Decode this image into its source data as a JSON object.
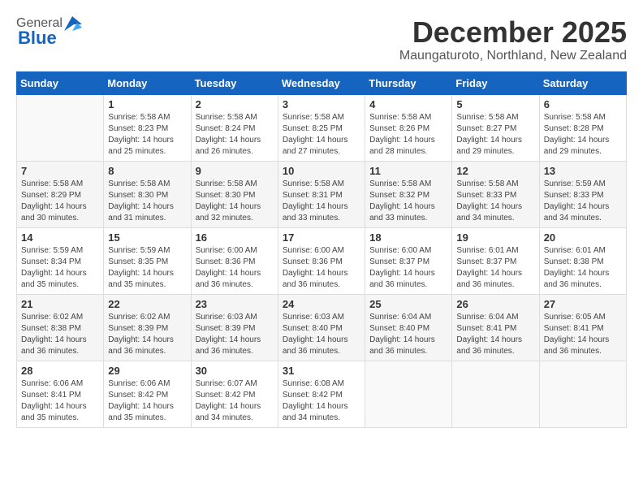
{
  "logo": {
    "general": "General",
    "blue": "Blue"
  },
  "title": {
    "month": "December 2025",
    "location": "Maungaturoto, Northland, New Zealand"
  },
  "weekdays": [
    "Sunday",
    "Monday",
    "Tuesday",
    "Wednesday",
    "Thursday",
    "Friday",
    "Saturday"
  ],
  "weeks": [
    [
      {
        "day": "",
        "info": ""
      },
      {
        "day": "1",
        "info": "Sunrise: 5:58 AM\nSunset: 8:23 PM\nDaylight: 14 hours\nand 25 minutes."
      },
      {
        "day": "2",
        "info": "Sunrise: 5:58 AM\nSunset: 8:24 PM\nDaylight: 14 hours\nand 26 minutes."
      },
      {
        "day": "3",
        "info": "Sunrise: 5:58 AM\nSunset: 8:25 PM\nDaylight: 14 hours\nand 27 minutes."
      },
      {
        "day": "4",
        "info": "Sunrise: 5:58 AM\nSunset: 8:26 PM\nDaylight: 14 hours\nand 28 minutes."
      },
      {
        "day": "5",
        "info": "Sunrise: 5:58 AM\nSunset: 8:27 PM\nDaylight: 14 hours\nand 29 minutes."
      },
      {
        "day": "6",
        "info": "Sunrise: 5:58 AM\nSunset: 8:28 PM\nDaylight: 14 hours\nand 29 minutes."
      }
    ],
    [
      {
        "day": "7",
        "info": "Sunrise: 5:58 AM\nSunset: 8:29 PM\nDaylight: 14 hours\nand 30 minutes."
      },
      {
        "day": "8",
        "info": "Sunrise: 5:58 AM\nSunset: 8:30 PM\nDaylight: 14 hours\nand 31 minutes."
      },
      {
        "day": "9",
        "info": "Sunrise: 5:58 AM\nSunset: 8:30 PM\nDaylight: 14 hours\nand 32 minutes."
      },
      {
        "day": "10",
        "info": "Sunrise: 5:58 AM\nSunset: 8:31 PM\nDaylight: 14 hours\nand 33 minutes."
      },
      {
        "day": "11",
        "info": "Sunrise: 5:58 AM\nSunset: 8:32 PM\nDaylight: 14 hours\nand 33 minutes."
      },
      {
        "day": "12",
        "info": "Sunrise: 5:58 AM\nSunset: 8:33 PM\nDaylight: 14 hours\nand 34 minutes."
      },
      {
        "day": "13",
        "info": "Sunrise: 5:59 AM\nSunset: 8:33 PM\nDaylight: 14 hours\nand 34 minutes."
      }
    ],
    [
      {
        "day": "14",
        "info": "Sunrise: 5:59 AM\nSunset: 8:34 PM\nDaylight: 14 hours\nand 35 minutes."
      },
      {
        "day": "15",
        "info": "Sunrise: 5:59 AM\nSunset: 8:35 PM\nDaylight: 14 hours\nand 35 minutes."
      },
      {
        "day": "16",
        "info": "Sunrise: 6:00 AM\nSunset: 8:36 PM\nDaylight: 14 hours\nand 36 minutes."
      },
      {
        "day": "17",
        "info": "Sunrise: 6:00 AM\nSunset: 8:36 PM\nDaylight: 14 hours\nand 36 minutes."
      },
      {
        "day": "18",
        "info": "Sunrise: 6:00 AM\nSunset: 8:37 PM\nDaylight: 14 hours\nand 36 minutes."
      },
      {
        "day": "19",
        "info": "Sunrise: 6:01 AM\nSunset: 8:37 PM\nDaylight: 14 hours\nand 36 minutes."
      },
      {
        "day": "20",
        "info": "Sunrise: 6:01 AM\nSunset: 8:38 PM\nDaylight: 14 hours\nand 36 minutes."
      }
    ],
    [
      {
        "day": "21",
        "info": "Sunrise: 6:02 AM\nSunset: 8:38 PM\nDaylight: 14 hours\nand 36 minutes."
      },
      {
        "day": "22",
        "info": "Sunrise: 6:02 AM\nSunset: 8:39 PM\nDaylight: 14 hours\nand 36 minutes."
      },
      {
        "day": "23",
        "info": "Sunrise: 6:03 AM\nSunset: 8:39 PM\nDaylight: 14 hours\nand 36 minutes."
      },
      {
        "day": "24",
        "info": "Sunrise: 6:03 AM\nSunset: 8:40 PM\nDaylight: 14 hours\nand 36 minutes."
      },
      {
        "day": "25",
        "info": "Sunrise: 6:04 AM\nSunset: 8:40 PM\nDaylight: 14 hours\nand 36 minutes."
      },
      {
        "day": "26",
        "info": "Sunrise: 6:04 AM\nSunset: 8:41 PM\nDaylight: 14 hours\nand 36 minutes."
      },
      {
        "day": "27",
        "info": "Sunrise: 6:05 AM\nSunset: 8:41 PM\nDaylight: 14 hours\nand 36 minutes."
      }
    ],
    [
      {
        "day": "28",
        "info": "Sunrise: 6:06 AM\nSunset: 8:41 PM\nDaylight: 14 hours\nand 35 minutes."
      },
      {
        "day": "29",
        "info": "Sunrise: 6:06 AM\nSunset: 8:42 PM\nDaylight: 14 hours\nand 35 minutes."
      },
      {
        "day": "30",
        "info": "Sunrise: 6:07 AM\nSunset: 8:42 PM\nDaylight: 14 hours\nand 34 minutes."
      },
      {
        "day": "31",
        "info": "Sunrise: 6:08 AM\nSunset: 8:42 PM\nDaylight: 14 hours\nand 34 minutes."
      },
      {
        "day": "",
        "info": ""
      },
      {
        "day": "",
        "info": ""
      },
      {
        "day": "",
        "info": ""
      }
    ]
  ]
}
